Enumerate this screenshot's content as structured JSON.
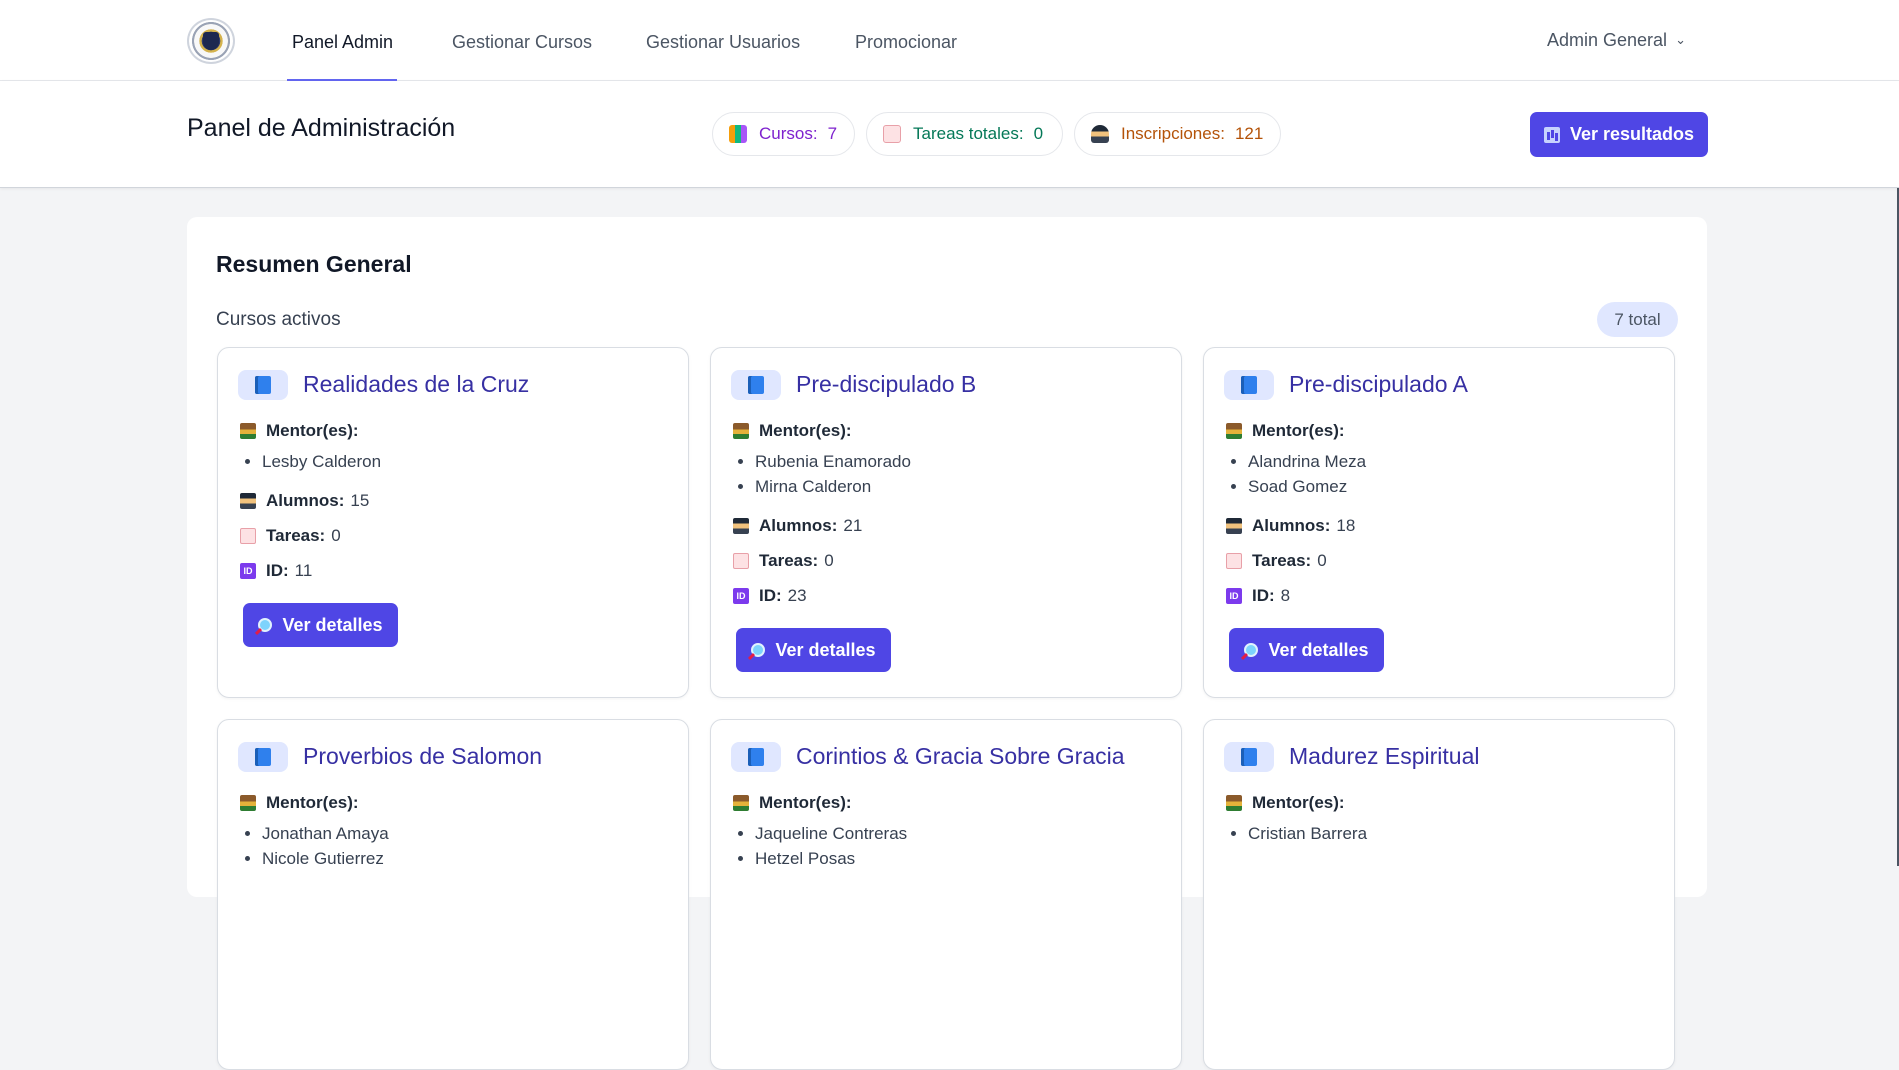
{
  "nav": {
    "items": [
      {
        "label": "Panel Admin",
        "active": true
      },
      {
        "label": "Gestionar Cursos",
        "active": false
      },
      {
        "label": "Gestionar Usuarios",
        "active": false
      },
      {
        "label": "Promocionar",
        "active": false
      }
    ],
    "user_menu": "Admin General",
    "accent": "#6366f1"
  },
  "header": {
    "title": "Panel de Administración",
    "stats": [
      {
        "label": "Cursos:",
        "value": "7",
        "color": "#7e22ce",
        "icon": "books-icon"
      },
      {
        "label": "Tareas totales:",
        "value": "0",
        "color": "#047857",
        "icon": "memo-icon"
      },
      {
        "label": "Inscripciones:",
        "value": "121",
        "color": "#b45309",
        "icon": "student-icon"
      }
    ],
    "results_button": "Ver resultados"
  },
  "summary": {
    "title": "Resumen General",
    "active_label": "Cursos activos",
    "total_badge": "7 total"
  },
  "labels": {
    "mentors": "Mentor(es):",
    "students": "Alumnos:",
    "tasks": "Tareas:",
    "id": "ID:",
    "details_button": "Ver detalles"
  },
  "courses": [
    {
      "title": "Realidades de la Cruz",
      "mentors": [
        "Lesby Calderon"
      ],
      "students": "15",
      "tasks": "0",
      "id": "11"
    },
    {
      "title": "Pre-discipulado B",
      "mentors": [
        "Rubenia Enamorado",
        "Mirna Calderon"
      ],
      "students": "21",
      "tasks": "0",
      "id": "23"
    },
    {
      "title": "Pre-discipulado A",
      "mentors": [
        "Alandrina Meza",
        "Soad Gomez"
      ],
      "students": "18",
      "tasks": "0",
      "id": "8"
    },
    {
      "title": "Proverbios de Salomon",
      "mentors": [
        "Jonathan Amaya",
        "Nicole Gutierrez"
      ]
    },
    {
      "title": "Corintios & Gracia Sobre Gracia",
      "mentors": [
        "Jaqueline Contreras",
        "Hetzel Posas"
      ]
    },
    {
      "title": "Madurez Espiritual",
      "mentors": [
        "Cristian Barrera"
      ]
    }
  ],
  "colors": {
    "primary_button": "#4f46e5",
    "course_title": "#3730a3",
    "background": "#f3f4f6"
  }
}
